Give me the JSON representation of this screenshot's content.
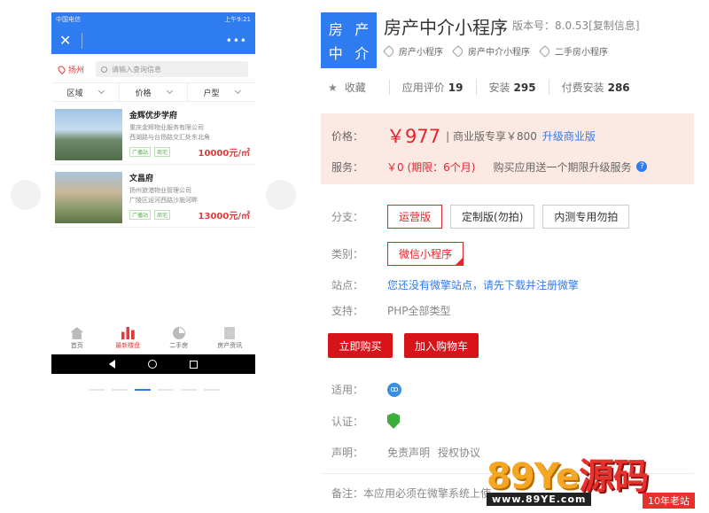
{
  "phone": {
    "status_carrier": "中国电信",
    "status_right": "上午9:21",
    "close_label": "✕",
    "more_label": "•••",
    "city": "扬州",
    "search_placeholder": "请输入查询信息",
    "filters": [
      "区域",
      "价格",
      "户型"
    ],
    "listings": [
      {
        "title": "金辉优步学府",
        "company": "重庆金辉物业服务有限公司",
        "address": "西湖路与台扬路交汇处东北角",
        "tags": [
          "广播站",
          "商宅"
        ],
        "price": "10000元/㎡"
      },
      {
        "title": "文昌府",
        "company": "扬州旅港物业管理公司",
        "address": "广陵区运河西路沙施河畔",
        "tags": [
          "广播站",
          "商宅"
        ],
        "price": "13000元/㎡"
      }
    ],
    "tabs": [
      {
        "label": "首页",
        "icon": "home-icon"
      },
      {
        "label": "最新楼盘",
        "icon": "bar-chart-icon",
        "active": true
      },
      {
        "label": "二手房",
        "icon": "pie-chart-icon"
      },
      {
        "label": "房产资讯",
        "icon": "document-icon"
      }
    ]
  },
  "product": {
    "logo_chars": [
      "房",
      "产",
      "中",
      "介"
    ],
    "title": "房产中介小程序",
    "version": "版本号：8.0.53[复制信息]",
    "tags": [
      "房产小程序",
      "房产中介小程序",
      "二手房小程序"
    ],
    "favorite": "收藏",
    "stats": [
      {
        "label": "应用评价",
        "value": "19"
      },
      {
        "label": "安装",
        "value": "295"
      },
      {
        "label": "付费安装",
        "value": "286"
      }
    ]
  },
  "pricing": {
    "price_label": "价格：",
    "price": "￥977",
    "commercial": "| 商业版专享￥800",
    "upgrade_link": "升级商业版",
    "service_label": "服务：",
    "service_value": "￥0 (期限：6个月)",
    "service_note": "购买应用送一个期限升级服务",
    "help": "?"
  },
  "options": {
    "branch_label": "分支：",
    "branches": [
      "运营版",
      "定制版(勿拍)",
      "内测专用勿拍"
    ],
    "type_label": "类别：",
    "type_value": "微信小程序",
    "site_label": "站点：",
    "site_value": "您还没有微擎站点，请先下载并注册微擎",
    "support_label": "支持：",
    "support_value": "PHP全部类型"
  },
  "actions": {
    "buy": "立即购买",
    "cart": "加入购物车"
  },
  "meta": {
    "applies_label": "适用：",
    "cert_label": "认证：",
    "statement_label": "声明：",
    "disclaimer": "免责声明",
    "license": "授权协议",
    "note": "备注：本应用必须在微擎系统上使"
  },
  "watermark": {
    "brand_num": "89Ye",
    "brand_cn": "源码",
    "url": "www.89YE.com",
    "tag": "10年老站"
  },
  "colors": {
    "accent_blue": "#2f7bf0",
    "price_red": "#e2262c",
    "button_red": "#d8141b",
    "price_bg": "#fde9e3"
  }
}
